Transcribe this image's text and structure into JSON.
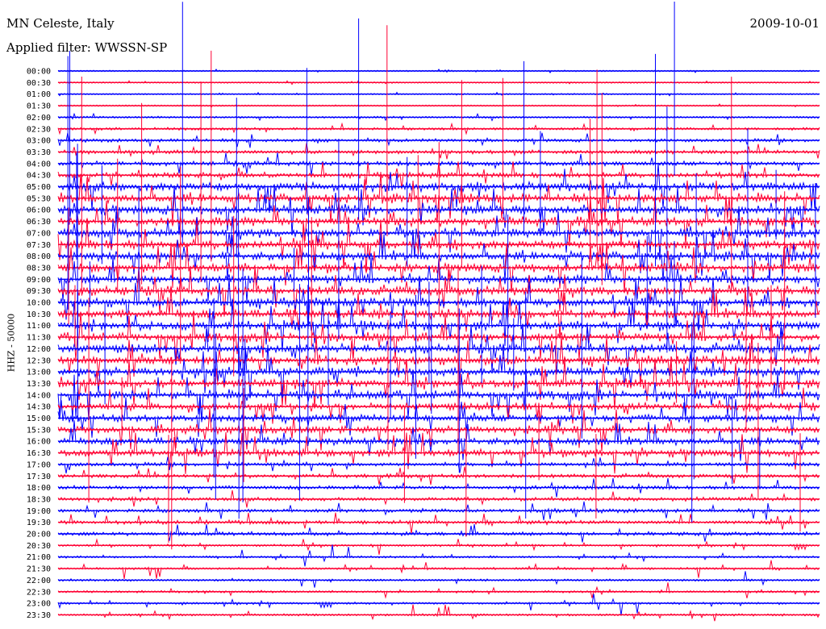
{
  "header": {
    "station": "MN Celeste, Italy",
    "date": "2009-10-01",
    "filter": "Applied filter: WWSSN-SP"
  },
  "chart_data": {
    "type": "line",
    "title": "MN Celeste, Italy",
    "ylabel": "HHZ - 50000",
    "row_labels": [
      "00:00",
      "00:30",
      "01:00",
      "01:30",
      "02:00",
      "02:30",
      "03:00",
      "03:30",
      "04:00",
      "04:30",
      "05:00",
      "05:30",
      "06:00",
      "06:30",
      "07:00",
      "07:30",
      "08:00",
      "08:30",
      "09:00",
      "09:30",
      "10:00",
      "10:30",
      "11:00",
      "11:30",
      "12:00",
      "12:30",
      "13:00",
      "13:30",
      "14:00",
      "14:30",
      "15:00",
      "15:30",
      "16:00",
      "16:30",
      "17:00",
      "17:30",
      "18:00",
      "18:30",
      "19:00",
      "19:30",
      "20:00",
      "20:30",
      "21:00",
      "21:30",
      "22:00",
      "22:30",
      "23:00",
      "23:30"
    ],
    "row_minutes": 30,
    "colors": [
      "#0000ff",
      "#ff0033"
    ],
    "grid": false,
    "legend": "none"
  }
}
